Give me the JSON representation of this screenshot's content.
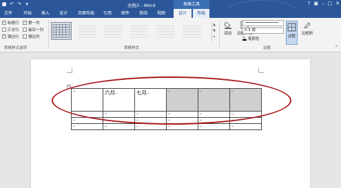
{
  "window": {
    "title": "文档3 - Word",
    "context_title": "表格工具"
  },
  "qat": {
    "icons": [
      "save-icon",
      "undo-icon",
      "redo-icon",
      "customize-icon"
    ]
  },
  "tabs": {
    "file": "文件",
    "home": "开始",
    "insert": "插入",
    "design_doc": "设计",
    "layout_page": "页面布局",
    "references": "引用",
    "mailings": "邮件",
    "review": "审阅",
    "view": "视图",
    "design_table": "设计",
    "layout_table": "布局"
  },
  "style_options": {
    "header_row": "标题行",
    "total_row": "汇总行",
    "banded_rows": "镶边行",
    "first_column": "第一列",
    "last_column": "最后一列",
    "banded_columns": "镶边列",
    "group_label": "表格样式选项"
  },
  "table_styles": {
    "group_label": "表格样式"
  },
  "borders": {
    "shading": "底纹",
    "border_styles": "边框样式",
    "pen_weight": "0.5 磅",
    "pen_color": "笔颜色",
    "borders": "边框",
    "border_painter": "边框刷",
    "group_label": "边框"
  },
  "document": {
    "header_cells": [
      "",
      "六月",
      "七月",
      "",
      "",
      "",
      ""
    ],
    "cell_mark": "↵",
    "row_count": 4,
    "col_count": 6
  },
  "colors": {
    "accent": "#2b579a",
    "annotation": "#a8171a",
    "header_shade": "#cfcfcf"
  }
}
